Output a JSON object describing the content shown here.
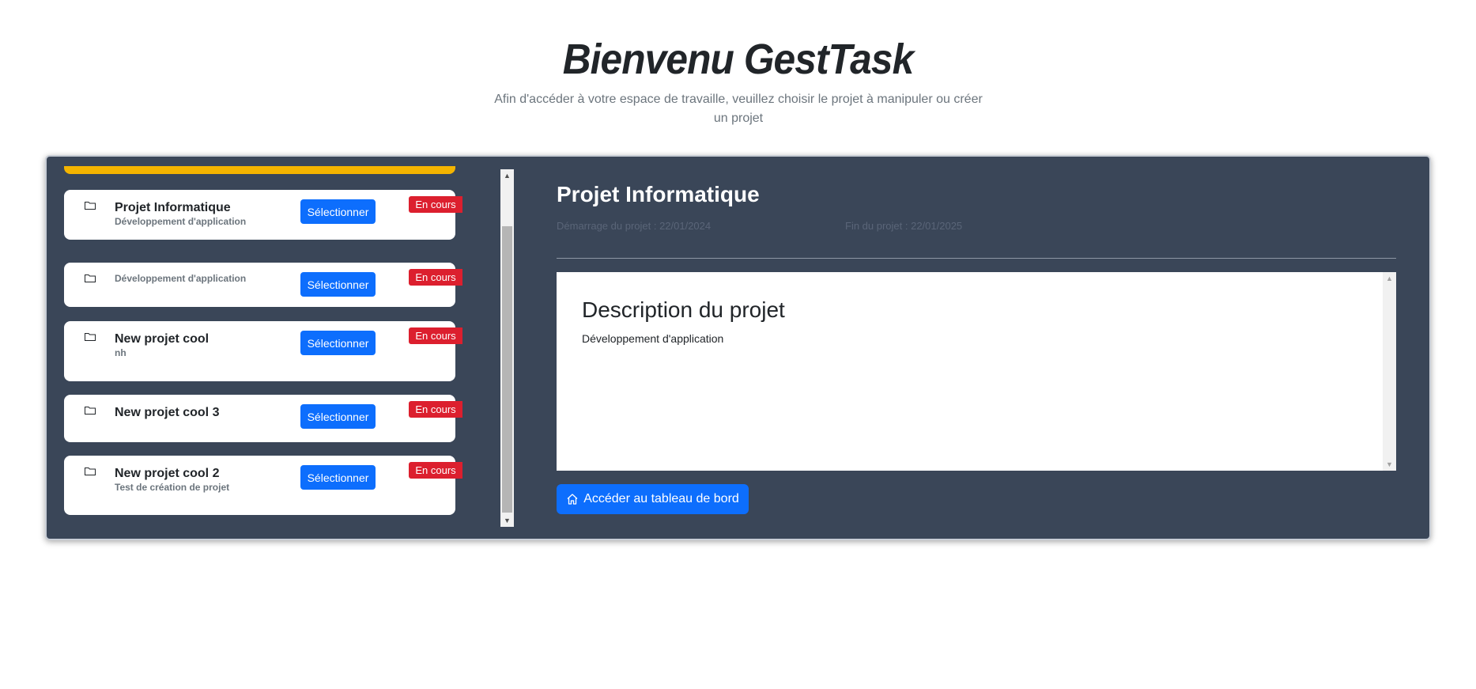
{
  "header": {
    "title": "Bienvenu GestTask",
    "subtitle": "Afin d'accéder à votre espace de travaille, veuillez choisir le projet à manipuler ou créer un projet"
  },
  "projects": [
    {
      "name": "Projet Informatique",
      "description": "Développement d'application",
      "select_label": "Sélectionner",
      "status": "En cours"
    },
    {
      "name": "",
      "description": "Développement d'application",
      "select_label": "Sélectionner",
      "status": "En cours"
    },
    {
      "name": "New projet cool",
      "description": "nh",
      "select_label": "Sélectionner",
      "status": "En cours"
    },
    {
      "name": "New projet cool 3",
      "description": "",
      "select_label": "Sélectionner",
      "status": "En cours"
    },
    {
      "name": "New projet cool 2",
      "description": "Test de création de projet",
      "select_label": "Sélectionner",
      "status": "En cours"
    }
  ],
  "detail": {
    "title": "Projet Informatique",
    "start": "Démarrage du projet : 22/01/2024",
    "end": "Fin du projet : 22/01/2025",
    "description_heading": "Description du projet",
    "description_text": "Développement d'application",
    "dashboard_button": "Accéder au tableau de bord"
  },
  "icons": {
    "folder": "folder-icon",
    "home": "home-icon",
    "scroll_up": "arrow-up-icon",
    "scroll_down": "arrow-down-icon"
  },
  "colors": {
    "panel_bg": "#3a4658",
    "primary": "#0d6efd",
    "badge": "#dc1f2e",
    "accent_strip": "#f4b400"
  }
}
